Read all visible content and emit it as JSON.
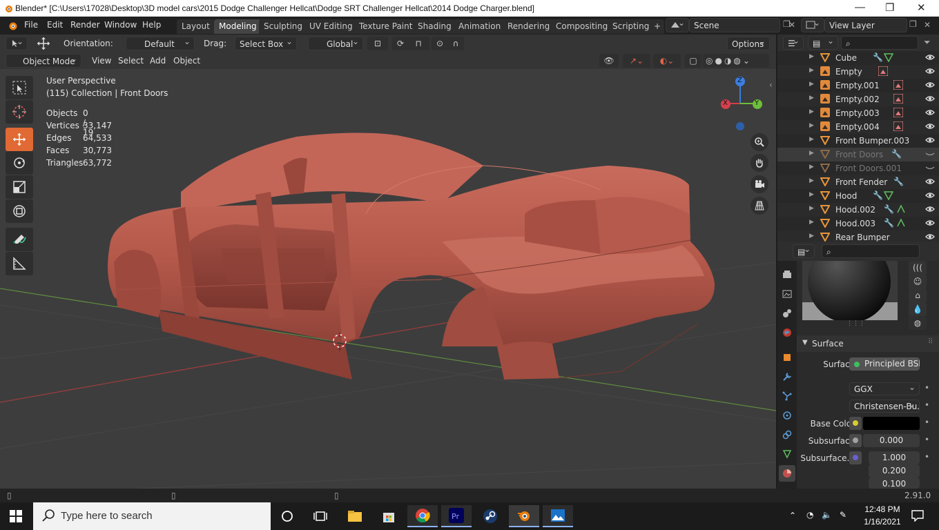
{
  "window": {
    "title": "Blender* [C:\\Users\\17028\\Desktop\\3D model cars\\2015 Dodge Challenger Hellcat\\Dodge SRT Challenger Hellcat\\2014 Dodge Charger.blend]",
    "minimize": "—",
    "maximize": "❐",
    "close": "✕"
  },
  "menu": [
    "File",
    "Edit",
    "Render",
    "Window",
    "Help"
  ],
  "workspace_tabs": [
    "Layout",
    "Modeling",
    "Sculpting",
    "UV Editing",
    "Texture Paint",
    "Shading",
    "Animation",
    "Rendering",
    "Compositing",
    "Scripting"
  ],
  "active_workspace": "Modeling",
  "add_workspace": "+",
  "scene": "Scene",
  "view_layer": "View Layer",
  "tool_header": {
    "orientation_label": "Orientation:",
    "orientation_value": "Default",
    "drag_label": "Drag:",
    "drag_value": "Select Box",
    "transform_orientation": "Global",
    "options": "Options"
  },
  "viewport_header": {
    "mode": "Object Mode",
    "menus": [
      "View",
      "Select",
      "Add",
      "Object"
    ]
  },
  "overlay": {
    "perspective": "User Perspective",
    "collection": "(115) Collection | Front Doors",
    "stats": [
      {
        "label": "Objects",
        "value": "0 / 19"
      },
      {
        "label": "Vertices",
        "value": "33,147"
      },
      {
        "label": "Edges",
        "value": "64,533"
      },
      {
        "label": "Faces",
        "value": "30,773"
      },
      {
        "label": "Triangles",
        "value": "63,772"
      }
    ]
  },
  "gizmo": {
    "x": "X",
    "y": "Y",
    "z": "Z"
  },
  "outliner": {
    "items": [
      {
        "name": "Cube",
        "type": "mesh",
        "state": "normal"
      },
      {
        "name": "Empty",
        "type": "empty",
        "state": "normal"
      },
      {
        "name": "Empty.001",
        "type": "empty",
        "state": "normal"
      },
      {
        "name": "Empty.002",
        "type": "empty",
        "state": "normal"
      },
      {
        "name": "Empty.003",
        "type": "empty",
        "state": "normal"
      },
      {
        "name": "Empty.004",
        "type": "empty",
        "state": "normal"
      },
      {
        "name": "Front Bumper.003",
        "type": "mesh",
        "state": "normal"
      },
      {
        "name": "Front Doors",
        "type": "mesh",
        "state": "selected-hidden"
      },
      {
        "name": "Front Doors.001",
        "type": "mesh",
        "state": "hidden"
      },
      {
        "name": "Front Fender",
        "type": "mesh",
        "state": "normal"
      },
      {
        "name": "Hood",
        "type": "mesh",
        "state": "normal"
      },
      {
        "name": "Hood.002",
        "type": "mesh",
        "state": "normal"
      },
      {
        "name": "Hood.003",
        "type": "mesh",
        "state": "normal"
      },
      {
        "name": "Rear Bumper",
        "type": "mesh",
        "state": "normal"
      }
    ]
  },
  "properties": {
    "panel_title": "Surface",
    "surface_label": "Surface",
    "surface_value": "Principled BSDF",
    "distribution": "GGX",
    "subsurface_method": "Christensen-Bu...",
    "base_color_label": "Base Color",
    "base_color": "#000000",
    "subsurface_label": "Subsurface",
    "subsurface_value": "0.000",
    "subsurface_radius_label": "Subsurface...",
    "subsurface_radius": [
      "1.000",
      "0.200",
      "0.100"
    ]
  },
  "status_bar": {
    "version": "2.91.0"
  },
  "taskbar": {
    "search_placeholder": "Type here to search",
    "time": "12:48 PM",
    "date": "1/16/2021",
    "apps": [
      "task-view",
      "file-explorer",
      "store",
      "chrome",
      "premiere-pro",
      "steam",
      "blender",
      "photos"
    ]
  },
  "colors": {
    "accent": "#e06934",
    "car_body": "#b5594b",
    "x_axis": "#d63f4a",
    "y_axis": "#6cbf3a",
    "z_axis": "#3b7ee0"
  }
}
